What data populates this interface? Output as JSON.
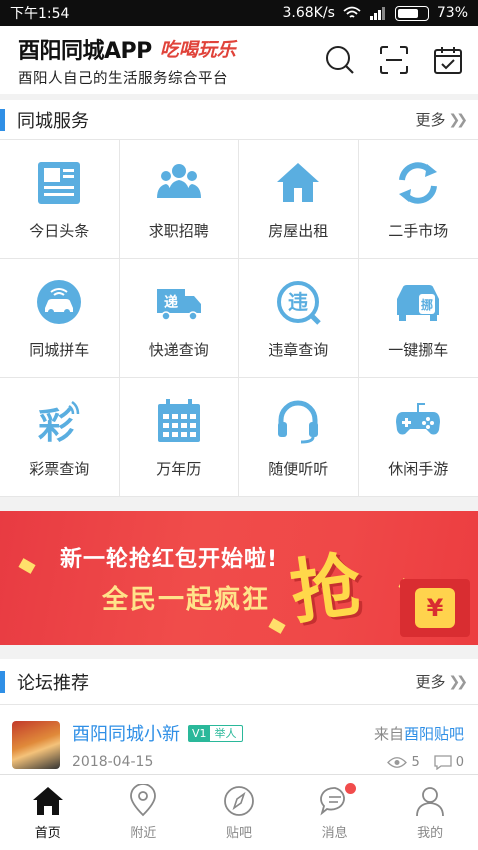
{
  "status_bar": {
    "time": "下午1:54",
    "speed": "3.68K/s",
    "battery": "73%",
    "battery_level": 0.73
  },
  "header": {
    "title": "酉阳同城APP",
    "logo_text": "吃喝玩乐",
    "subtitle": "酉阳人自己的生活服务综合平台"
  },
  "services": {
    "title": "同城服务",
    "more": "更多",
    "items": [
      {
        "label": "今日头条",
        "icon": "newspaper-icon"
      },
      {
        "label": "求职招聘",
        "icon": "people-icon"
      },
      {
        "label": "房屋出租",
        "icon": "house-icon"
      },
      {
        "label": "二手市场",
        "icon": "recycle-icon"
      },
      {
        "label": "同城拼车",
        "icon": "carpool-icon"
      },
      {
        "label": "快递查询",
        "icon": "delivery-truck-icon"
      },
      {
        "label": "违章查询",
        "icon": "violation-icon"
      },
      {
        "label": "一键挪车",
        "icon": "move-car-icon"
      },
      {
        "label": "彩票查询",
        "icon": "lottery-icon"
      },
      {
        "label": "万年历",
        "icon": "calendar-icon"
      },
      {
        "label": "随便听听",
        "icon": "headphones-icon"
      },
      {
        "label": "休闲手游",
        "icon": "gamepad-icon"
      }
    ]
  },
  "banner": {
    "line1": "新一轮抢红包开始啦!",
    "line2": "全民一起疯狂",
    "big": "抢",
    "coin": "¥"
  },
  "forum": {
    "title": "论坛推荐",
    "more": "更多",
    "post": {
      "author": "酉阳同城小新",
      "badge_v": "V1",
      "badge_text": "举人",
      "from_prefix": "来自",
      "from_forum": "酉阳贴吧",
      "date": "2018-04-15",
      "views": "5",
      "comments": "0"
    }
  },
  "tabbar": [
    {
      "label": "首页",
      "icon": "home-icon",
      "active": true
    },
    {
      "label": "附近",
      "icon": "location-icon",
      "active": false
    },
    {
      "label": "贴吧",
      "icon": "compass-icon",
      "active": false
    },
    {
      "label": "消息",
      "icon": "message-icon",
      "active": false
    },
    {
      "label": "我的",
      "icon": "profile-icon",
      "active": false
    }
  ],
  "colors": {
    "accent": "#2f8fe6",
    "icon_blue": "#5aaee0",
    "badge": "#e83b42"
  }
}
